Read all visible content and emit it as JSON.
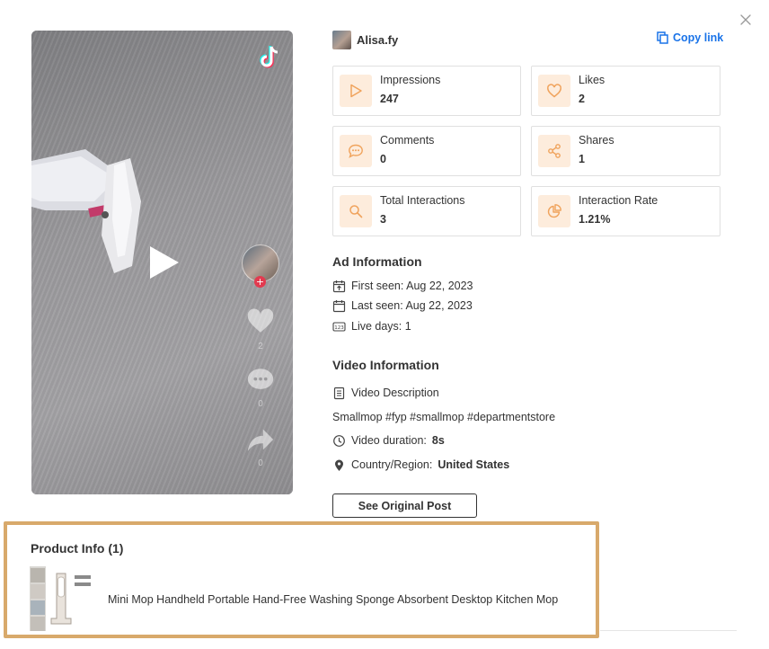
{
  "author": {
    "name": "Alisa.fy"
  },
  "actions": {
    "copy_link": "Copy link"
  },
  "stats": [
    {
      "label": "Impressions",
      "value": "247",
      "icon": "play-icon"
    },
    {
      "label": "Likes",
      "value": "2",
      "icon": "heart-icon"
    },
    {
      "label": "Comments",
      "value": "0",
      "icon": "comment-icon"
    },
    {
      "label": "Shares",
      "value": "1",
      "icon": "share-icon"
    },
    {
      "label": "Total Interactions",
      "value": "3",
      "icon": "search-icon"
    },
    {
      "label": "Interaction Rate",
      "value": "1.21%",
      "icon": "pie-chart-icon"
    }
  ],
  "video_overlay": {
    "likes": "2",
    "comments": "0",
    "shares": "0"
  },
  "ad_info": {
    "title": "Ad Information",
    "first_seen": "First seen: Aug 22, 2023",
    "last_seen": "Last seen: Aug 22, 2023",
    "live_days": "Live days: 1"
  },
  "video_info": {
    "title": "Video Information",
    "description_label": "Video Description",
    "description": "Smallmop #fyp #smallmop #departmentstore",
    "duration_label": "Video duration:",
    "duration": "8s",
    "country_label": "Country/Region:",
    "country": "United States"
  },
  "buttons": {
    "original_post": "See Original Post"
  },
  "product": {
    "title": "Product Info (1)",
    "name": "Mini Mop Handheld Portable Hand-Free Washing Sponge Absorbent Desktop Kitchen Mop"
  },
  "colors": {
    "accent": "#f0a35c",
    "icon_bg": "#fdecdc",
    "link": "#1a73e8",
    "highlight_border": "#d8a96b"
  }
}
